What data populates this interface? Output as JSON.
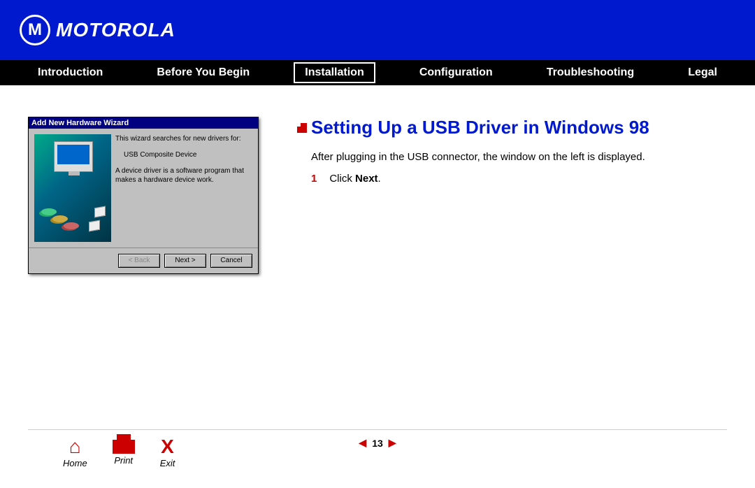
{
  "brand": "MOTOROLA",
  "nav": {
    "items": [
      {
        "label": "Introduction"
      },
      {
        "label": "Before You Begin"
      },
      {
        "label": "Installation"
      },
      {
        "label": "Configuration"
      },
      {
        "label": "Troubleshooting"
      },
      {
        "label": "Legal"
      }
    ],
    "active_index": 2
  },
  "wizard": {
    "title": "Add New Hardware Wizard",
    "line1": "This wizard searches for new drivers for:",
    "device": "USB Composite Device",
    "line2": "A device driver is a software program that makes a hardware device work.",
    "buttons": {
      "back": "< Back",
      "next": "Next >",
      "cancel": "Cancel"
    }
  },
  "page": {
    "title": "Setting Up a USB Driver in Windows 98",
    "intro": "After plugging in the USB connector, the window on the left is displayed.",
    "step_num": "1",
    "step_text_pre": "Click ",
    "step_bold": "Next",
    "step_text_post": "."
  },
  "footer": {
    "home": "Home",
    "print": "Print",
    "exit": "Exit",
    "page_number": "13"
  }
}
